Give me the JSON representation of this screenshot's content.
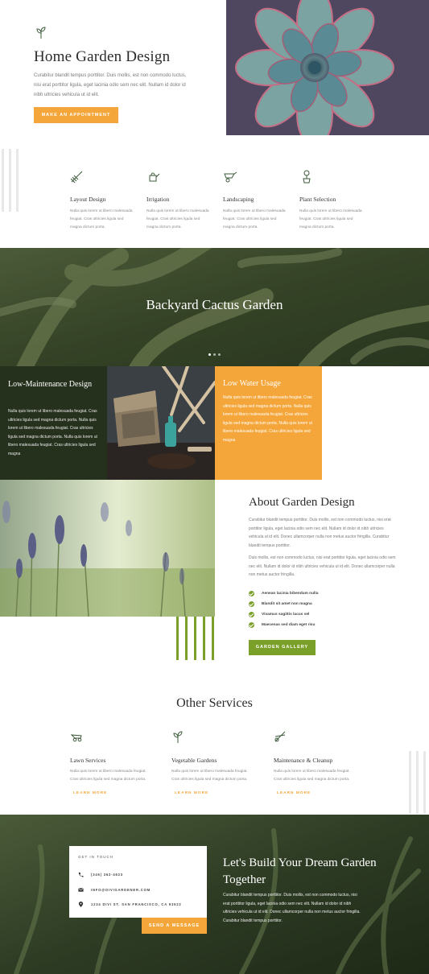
{
  "hero": {
    "title": "Home Garden Design",
    "text": "Curabitur blandit tempus porttitor. Duis mollis, est non commodo luctus, nisi erat porttitor ligula, eget lacinia odio sem nec elit. Nullam id dolor id nibh ultricies vehicula ut id elit.",
    "button": "MAKE AN APPOINTMENT"
  },
  "features": [
    {
      "icon": "rake-icon",
      "title": "Layout Design",
      "text": "Nulla quis lorem ut libero malesuada feugiat. Cras ultricies ligula sed magna dictum porta."
    },
    {
      "icon": "watering-can-icon",
      "title": "Irrigation",
      "text": "Nulla quis lorem ut libero malesuada feugiat. Cras ultricies ligula sed magna dictum porta."
    },
    {
      "icon": "wheelbarrow-icon",
      "title": "Landscaping",
      "text": "Nulla quis lorem ut libero malesuada feugiat. Cras ultricies ligula sed magna dictum porta."
    },
    {
      "icon": "flower-pot-icon",
      "title": "Plant Selection",
      "text": "Nulla quis lorem ut libero malesuada feugiat. Cras ultricies ligula sed magna dictum porta."
    }
  ],
  "banner": {
    "title": "Backyard Cactus Garden"
  },
  "low_maintenance": {
    "title": "Low-Maintenance Design",
    "text": "Nulla quis lorem ut libero malesuada feugiat. Cras ultricies ligula sed magna dictum porta. Nulla quis lorem ut libero malesuada feugiat. Cras ultricies ligula sed magna dictum porta. Nulla quis lorem ut libero malesuada feugiat. Cras ultricies ligula sed magna"
  },
  "low_water": {
    "title": "Low Water Usage",
    "text": "Nulla quis lorem ut libero malesuada feugiat. Cras ultricies ligula sed magna dictum porta. Nulla quis lorem ut libero malesuada feugiat. Cras ultricies ligula sed magna dictum porta. Nulla quis lorem ut libero malesuada feugiat. Cras ultricies ligula sed magna"
  },
  "about": {
    "title": "About Garden Design",
    "p1": "Curabitur blandit tempus porttitor. Duis mollis, est non commodo luctus, nisi erat porttitor ligula, eget lacinia odio sem nec elit. Nullam id dolor id nibh ultricies vehicula ut id elit. Donec ullamcorper nulla non metus auctor fringilla. Curabitur blandit tempus porttitor.",
    "p2": "Duis mollis, est non commodo luctus, nisi erat porttitor ligula, eget lacinia odio sem nec elit. Nullam id dolor id nibh ultricies vehicula ut id elit. Donec ullamcorper nulla non metus auctor fringilla.",
    "checks": [
      "Aenean lacinia bibendum nulla",
      "Blandit sit amet non magna",
      "Vivamus sagittis lacus vel",
      "Maecenas sed diam eget risu"
    ],
    "button": "GARDEN GALLERY"
  },
  "other_services": {
    "title": "Other Services",
    "items": [
      {
        "icon": "lawn-mower-icon",
        "title": "Lawn Services",
        "text": "Nulla quis lorem ut libero malesuada feugiat. Cras ultricies ligula sed magna dictum porta.",
        "link": "LEARN MORE"
      },
      {
        "icon": "sprout-icon",
        "title": "Vegetable Gardens",
        "text": "Nulla quis lorem ut libero malesuada feugiat. Cras ultricies ligula sed magna dictum porta.",
        "link": "LEARN MORE"
      },
      {
        "icon": "shears-icon",
        "title": "Maintenance & Cleanup",
        "text": "Nulla quis lorem ut libero malesuada feugiat. Cras ultricies ligula sed magna dictum porta.",
        "link": "LEARN MORE"
      }
    ]
  },
  "contact": {
    "heading": "GET IN TOUCH",
    "phone": "(346) 362-4623",
    "email": "INFO@DIVIGARDENER.COM",
    "address": "1234 DIVI ST. SAN FRANCISCO, CA 93522",
    "button": "SEND A MESSAGE"
  },
  "dream": {
    "title": "Let's Build Your Dream Garden Together",
    "text": "Curabitur blandit tempus porttitor. Duis mollis, est non commodo luctus, nisi erat porttitor ligula, eget lacinia odio sem nec elit. Nullam id dolor id nibh ultricies vehicula ut id elit. Donec ullamcorper nulla non metus auctor fringilla. Curabitur blandit tempus porttitor."
  },
  "colors": {
    "accent_orange": "#f5a63a",
    "accent_green": "#7aa02a",
    "dark_green": "#25301d",
    "icon_green": "#3d5a3a"
  }
}
